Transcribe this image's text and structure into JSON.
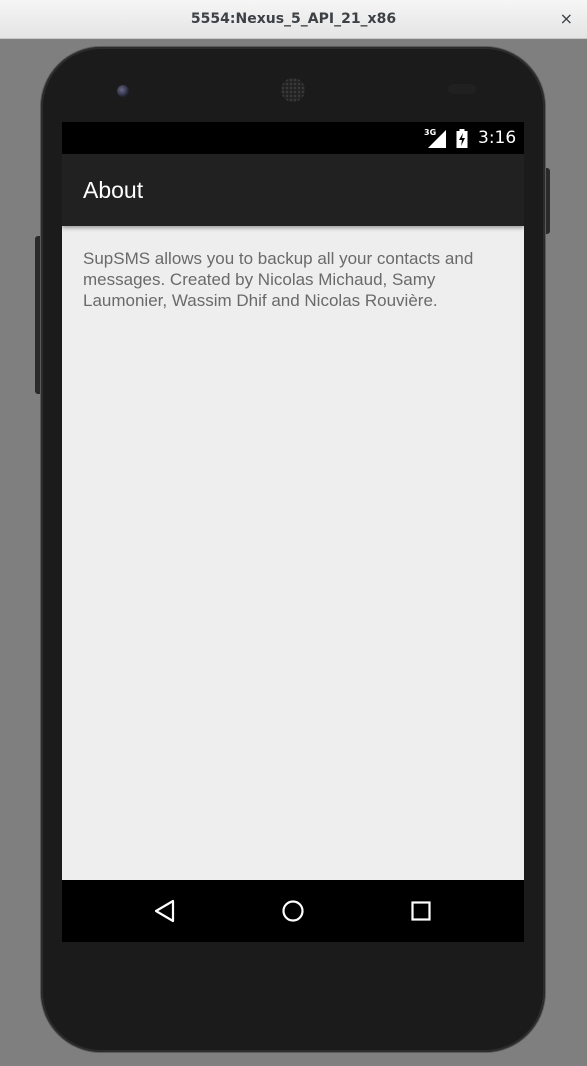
{
  "window": {
    "title": "5554:Nexus_5_API_21_x86",
    "close_glyph": "×"
  },
  "status_bar": {
    "network_type": "3G",
    "time": "3:16",
    "icons": [
      "signal-icon",
      "battery-charging-icon"
    ]
  },
  "app_bar": {
    "title": "About",
    "background": "#212121"
  },
  "content": {
    "text": "SupSMS allows you to backup all your contacts and messages. Created by Nicolas Michaud, Samy Laumonier, Wassim Dhif and Nicolas Rouvière."
  },
  "nav_bar": {
    "buttons": [
      "back-icon",
      "home-icon",
      "recents-icon"
    ]
  },
  "colors": {
    "screen_background": "#eeeeee",
    "text": "#6a6a6a",
    "emulator_background": "#7f7f7f"
  }
}
